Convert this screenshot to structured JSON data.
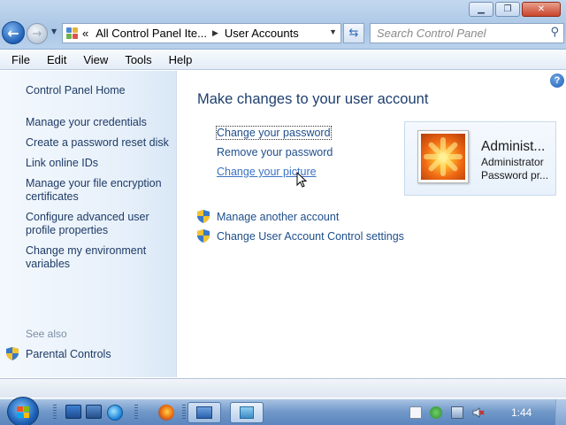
{
  "window": {
    "controls": [
      "minimize",
      "maximize",
      "close"
    ]
  },
  "address": {
    "overflow": "«",
    "crumbs": [
      "All Control Panel Ite...",
      "User Accounts"
    ]
  },
  "search": {
    "placeholder": "Search Control Panel"
  },
  "menu": [
    "File",
    "Edit",
    "View",
    "Tools",
    "Help"
  ],
  "sidebar": {
    "home": "Control Panel Home",
    "links": [
      "Manage your credentials",
      "Create a password reset disk",
      "Link online IDs",
      "Manage your file encryption certificates",
      "Configure advanced user profile properties",
      "Change my environment variables"
    ],
    "see_also_label": "See also",
    "see_also_links": [
      "Parental Controls"
    ]
  },
  "main": {
    "heading": "Make changes to your user account",
    "tasks": [
      "Change your password",
      "Remove your password",
      "Change your picture"
    ],
    "admin_tasks": [
      "Manage another account",
      "Change User Account Control settings"
    ]
  },
  "user": {
    "name": "Administ...",
    "type": "Administrator",
    "password_status": "Password pr..."
  },
  "taskbar": {
    "clock": "1:44"
  },
  "colors": {
    "link": "#1e4e8c",
    "heading": "#1e3f6e",
    "sidebar_bg": "#e7f0fa"
  }
}
